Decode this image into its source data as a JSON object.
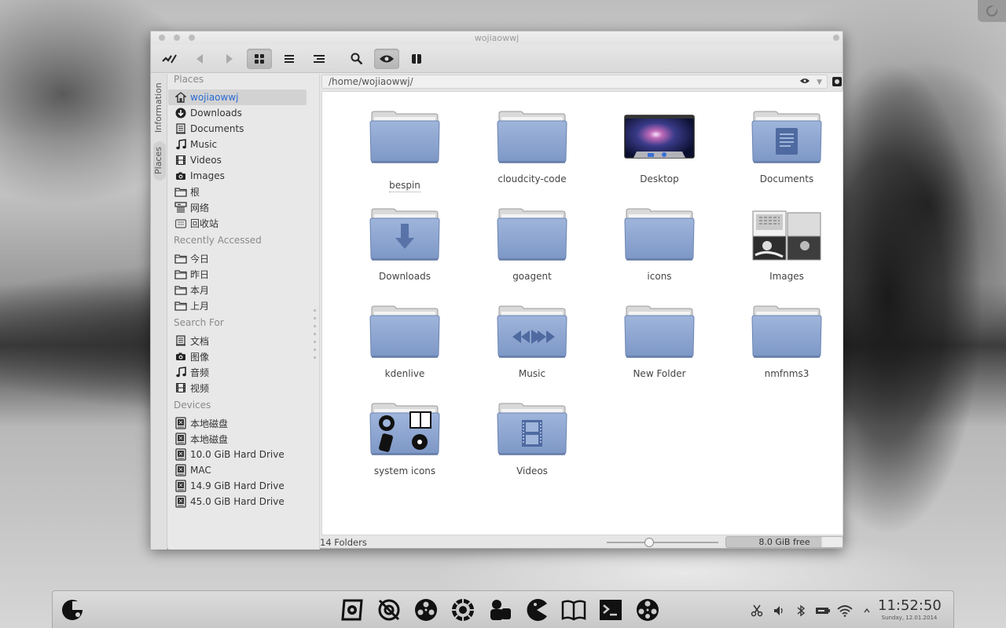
{
  "window": {
    "title": "wojiaowwj"
  },
  "toolbar": {
    "buttons": [
      "app-menu-icon",
      "back-icon",
      "forward-icon",
      "icon-view-icon",
      "list-view-icon",
      "tree-view-icon",
      "search-icon",
      "preview-eye-icon",
      "split-view-icon"
    ]
  },
  "vertical_tabs": {
    "information": "Information",
    "places": "Places"
  },
  "sidebar": {
    "places_title": "Places",
    "places": [
      {
        "label": "wojiaowwj",
        "icon": "home-icon"
      },
      {
        "label": "Downloads",
        "icon": "download-icon"
      },
      {
        "label": "Documents",
        "icon": "document-icon"
      },
      {
        "label": "Music",
        "icon": "music-note-icon"
      },
      {
        "label": "Videos",
        "icon": "film-icon"
      },
      {
        "label": "Images",
        "icon": "camera-icon"
      },
      {
        "label": "根",
        "icon": "folder-icon"
      },
      {
        "label": "网络",
        "icon": "network-icon"
      },
      {
        "label": "回收站",
        "icon": "trash-icon"
      }
    ],
    "recent_title": "Recently Accessed",
    "recent": [
      {
        "label": "今日",
        "icon": "folder-icon"
      },
      {
        "label": "昨日",
        "icon": "folder-icon"
      },
      {
        "label": "本月",
        "icon": "folder-icon"
      },
      {
        "label": "上月",
        "icon": "folder-icon"
      }
    ],
    "search_title": "Search For",
    "search": [
      {
        "label": "文档",
        "icon": "document-icon"
      },
      {
        "label": "图像",
        "icon": "camera-icon"
      },
      {
        "label": "音频",
        "icon": "music-note-icon"
      },
      {
        "label": "视频",
        "icon": "film-icon"
      }
    ],
    "devices_title": "Devices",
    "devices": [
      {
        "label": "本地磁盘",
        "icon": "drive-icon"
      },
      {
        "label": "本地磁盘",
        "icon": "drive-icon"
      },
      {
        "label": "10.0 GiB Hard Drive",
        "icon": "drive-icon"
      },
      {
        "label": "MAC",
        "icon": "drive-icon"
      },
      {
        "label": "14.9 GiB Hard Drive",
        "icon": "drive-icon"
      },
      {
        "label": "45.0 GiB Hard Drive",
        "icon": "drive-icon"
      }
    ]
  },
  "path": {
    "value": "/home/wojiaowwj/"
  },
  "files": [
    {
      "name": "bespin",
      "kind": "plain"
    },
    {
      "name": "cloudcity-code",
      "kind": "plain"
    },
    {
      "name": "Desktop",
      "kind": "desktop"
    },
    {
      "name": "Documents",
      "kind": "documents"
    },
    {
      "name": "Downloads",
      "kind": "downloads"
    },
    {
      "name": "goagent",
      "kind": "plain"
    },
    {
      "name": "icons",
      "kind": "plain"
    },
    {
      "name": "Images",
      "kind": "images"
    },
    {
      "name": "kdenlive",
      "kind": "plain"
    },
    {
      "name": "Music",
      "kind": "music"
    },
    {
      "name": "New Folder",
      "kind": "plain"
    },
    {
      "name": "nmfnms3",
      "kind": "plain"
    },
    {
      "name": "system icons",
      "kind": "system"
    },
    {
      "name": "Videos",
      "kind": "videos"
    }
  ],
  "status": {
    "count": "14 Folders",
    "free": "8.0 GiB free",
    "free_fraction_used": 0.82,
    "zoom_fraction": 0.38
  },
  "dock": {
    "apps": [
      "file-manager-icon",
      "settings-icon",
      "media-player-icon",
      "browser-icon",
      "chat-icon",
      "pacman-game-icon",
      "book-reader-icon",
      "terminal-icon",
      "film-reel-icon"
    ],
    "tray": [
      "scissors-icon",
      "volume-icon",
      "bluetooth-icon",
      "battery-icon",
      "wifi-icon",
      "tray-expand-icon"
    ],
    "time": "11:52:50",
    "date": "Sunday, 12.01.2014"
  },
  "colors": {
    "folder_blue": "#8aa4cf",
    "selection_text": "#2a6ad4"
  }
}
